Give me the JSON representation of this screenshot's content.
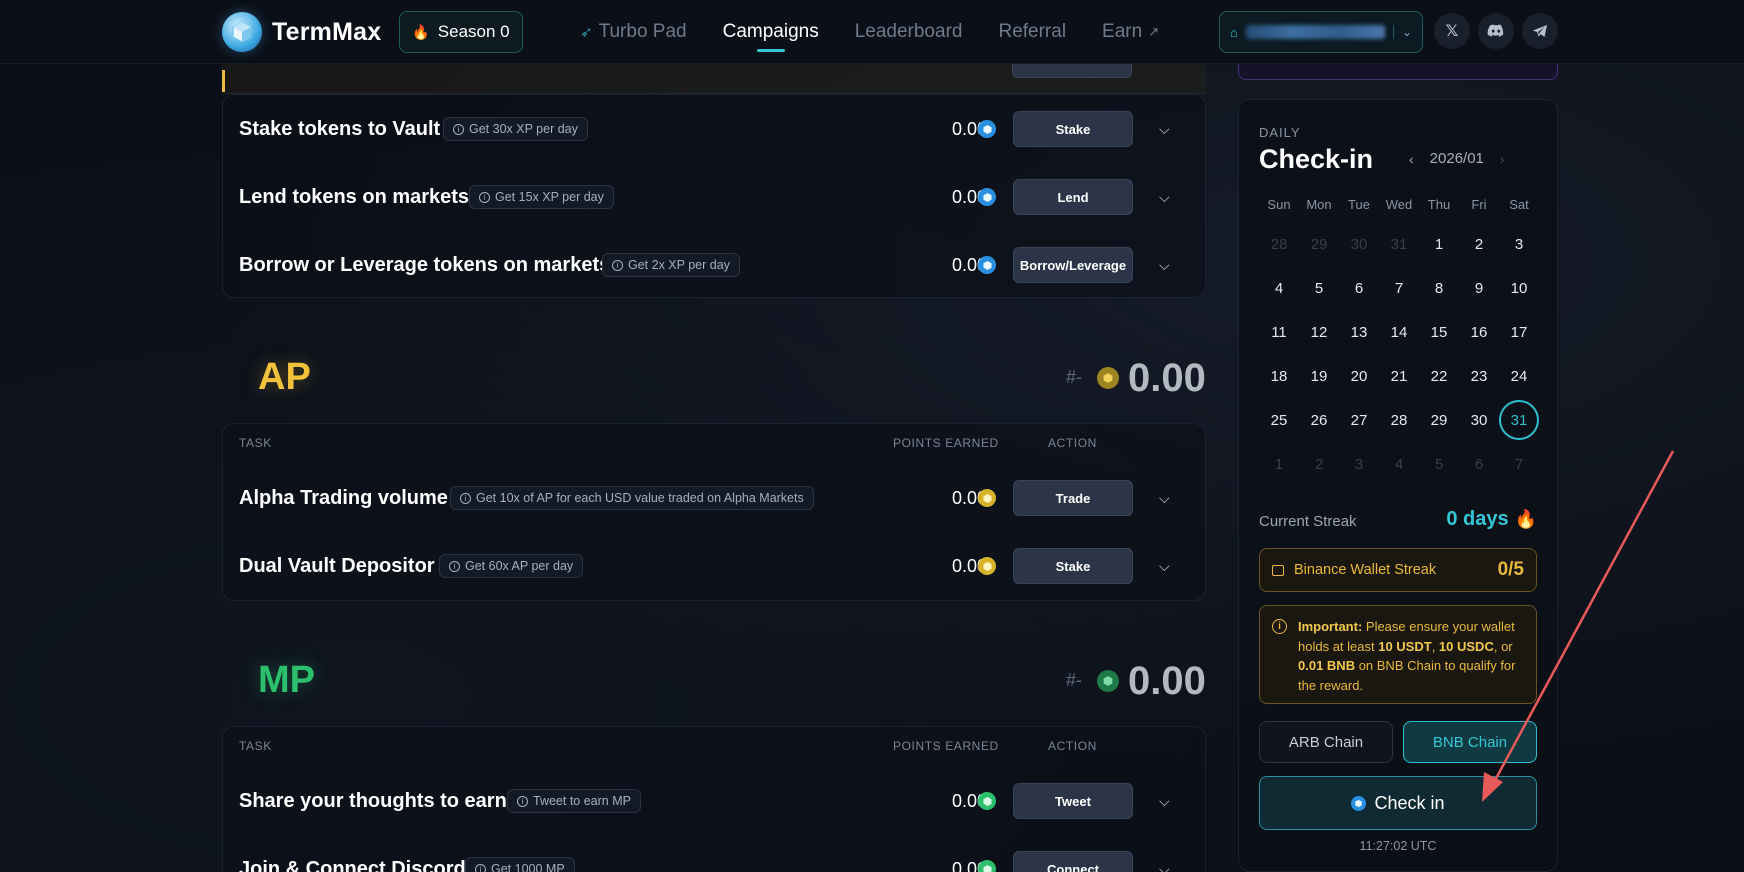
{
  "header": {
    "brand": "TermMax",
    "season_label": "Season 0",
    "nav": [
      {
        "label": "Turbo Pad",
        "icon": "rocket-icon"
      },
      {
        "label": "Campaigns",
        "active": true
      },
      {
        "label": "Leaderboard"
      },
      {
        "label": "Referral"
      },
      {
        "label": "Earn",
        "icon": "external-link-icon"
      }
    ],
    "social": [
      "x-icon",
      "discord-icon",
      "telegram-icon"
    ]
  },
  "xp_tasks": [
    {
      "title": "Stake tokens to Vault",
      "hint": "Get 30x XP per day",
      "points": "0.00",
      "action": "Stake"
    },
    {
      "title": "Lend tokens on markets",
      "hint": "Get 15x XP per day",
      "points": "0.00",
      "action": "Lend"
    },
    {
      "title": "Borrow or Leverage tokens on markets",
      "hint": "Get 2x XP per day",
      "points": "0.00",
      "action": "Borrow/Leverage"
    }
  ],
  "ap": {
    "title": "AP",
    "rank": "#-",
    "value": "0.00",
    "col_task": "TASK",
    "col_points": "POINTS EARNED",
    "col_action": "ACTION",
    "tasks": [
      {
        "title": "Alpha Trading volume",
        "hint": "Get 10x of AP for each USD value traded on Alpha Markets",
        "points": "0.00",
        "action": "Trade"
      },
      {
        "title": "Dual Vault Depositor",
        "hint": "Get 60x AP per day",
        "points": "0.00",
        "action": "Stake"
      }
    ]
  },
  "mp": {
    "title": "MP",
    "rank": "#-",
    "value": "0.00",
    "col_task": "TASK",
    "col_points": "POINTS EARNED",
    "col_action": "ACTION",
    "tasks": [
      {
        "title": "Share your thoughts to earn",
        "hint": "Tweet to earn MP",
        "points": "0.00",
        "action": "Tweet"
      },
      {
        "title": "Join & Connect Discord",
        "hint": "Get 1000 MP",
        "points": "0.00",
        "action": "Connect"
      }
    ]
  },
  "checkin": {
    "daily_label": "DAILY",
    "title": "Check-in",
    "month": "2026/01",
    "weekdays": [
      "Sun",
      "Mon",
      "Tue",
      "Wed",
      "Thu",
      "Fri",
      "Sat"
    ],
    "days": [
      {
        "d": "28",
        "dim": true
      },
      {
        "d": "29",
        "dim": true
      },
      {
        "d": "30",
        "dim": true
      },
      {
        "d": "31",
        "dim": true
      },
      {
        "d": "1"
      },
      {
        "d": "2"
      },
      {
        "d": "3"
      },
      {
        "d": "4"
      },
      {
        "d": "5"
      },
      {
        "d": "6"
      },
      {
        "d": "7"
      },
      {
        "d": "8"
      },
      {
        "d": "9"
      },
      {
        "d": "10"
      },
      {
        "d": "11"
      },
      {
        "d": "12"
      },
      {
        "d": "13"
      },
      {
        "d": "14"
      },
      {
        "d": "15"
      },
      {
        "d": "16"
      },
      {
        "d": "17"
      },
      {
        "d": "18"
      },
      {
        "d": "19"
      },
      {
        "d": "20"
      },
      {
        "d": "21"
      },
      {
        "d": "22"
      },
      {
        "d": "23"
      },
      {
        "d": "24"
      },
      {
        "d": "25"
      },
      {
        "d": "26"
      },
      {
        "d": "27"
      },
      {
        "d": "28"
      },
      {
        "d": "29"
      },
      {
        "d": "30"
      },
      {
        "d": "31",
        "today": true
      },
      {
        "d": "1",
        "dim": true
      },
      {
        "d": "2",
        "dim": true
      },
      {
        "d": "3",
        "dim": true
      },
      {
        "d": "4",
        "dim": true
      },
      {
        "d": "5",
        "dim": true
      },
      {
        "d": "6",
        "dim": true
      },
      {
        "d": "7",
        "dim": true
      }
    ],
    "streak_label": "Current Streak",
    "streak_value": "0 days",
    "bws_label": "Binance Wallet Streak",
    "bws_value": "0/5",
    "notice_important": "Important:",
    "notice_t1": " Please ensure your wallet holds at least ",
    "notice_b1": "10 USDT",
    "notice_t2": ", ",
    "notice_b2": "10 USDC",
    "notice_t3": ", or ",
    "notice_b3": "0.01 BNB",
    "notice_t4": " on BNB Chain to qualify for the reward.",
    "chain_arb": "ARB Chain",
    "chain_bnb": "BNB Chain",
    "button": "Check in",
    "time": "11:27:02 UTC"
  },
  "colors": {
    "accent": "#35c6d6",
    "ap": "#f2c23a",
    "mp": "#2cbf6c",
    "warning": "#e8b93a",
    "annotation_arrow": "#e85a5a"
  }
}
